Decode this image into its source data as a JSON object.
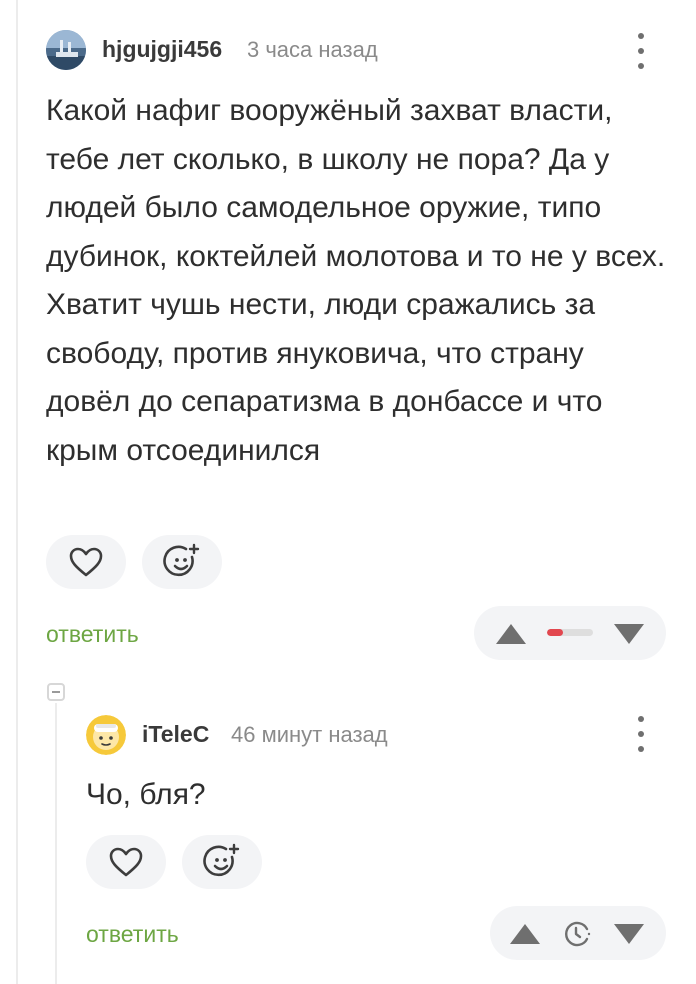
{
  "comment": {
    "username": "hjgujgji456",
    "time": "3 часа назад",
    "body": "Какой нафиг вооружёный захват власти, тебе лет сколько, в школу не пора? Да у людей было самодельное оружие, типо дубинок, коктейлей молотова и то не у всех. Хватит чушь нести, люди сражались за свободу, против януковича, что страну довёл до сепаратизма в донбассе и что крым отсоединился",
    "reply_label": "ответить",
    "rating_negative_fraction": 0.35,
    "icons": [
      "heart-icon",
      "smile-plus-icon",
      "arrow-up-icon",
      "arrow-down-icon",
      "more-vertical-icon"
    ]
  },
  "reply": {
    "username": "iTeleC",
    "time": "46 минут назад",
    "body": "Чо, бля?",
    "reply_label": "ответить",
    "icons": [
      "heart-icon",
      "smile-plus-icon",
      "arrow-up-icon",
      "clock-icon",
      "arrow-down-icon",
      "more-vertical-icon"
    ]
  },
  "colors": {
    "reply_link": "#6da643",
    "rating_negative": "#e2474f",
    "button_bg": "#f3f4f6",
    "text": "#2e2e2e",
    "muted": "#8a8a8a"
  }
}
